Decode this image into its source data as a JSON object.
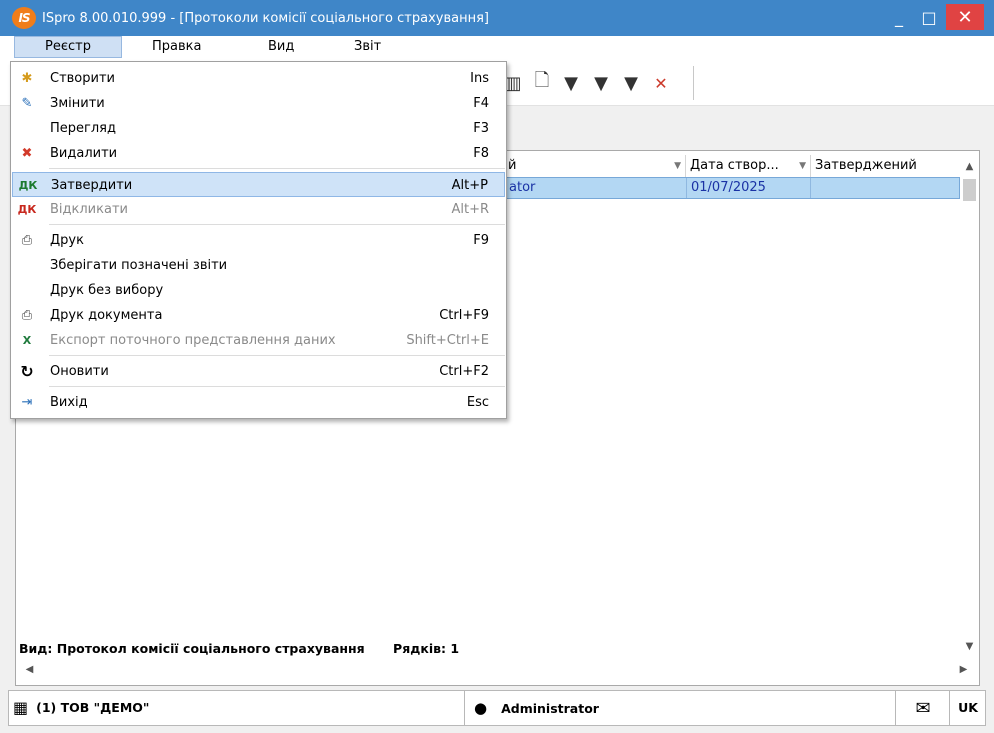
{
  "window": {
    "logo_text": "IS",
    "title": "ISpro 8.00.010.999 - [Протоколи комісії соціального страхування]",
    "minimize": "_",
    "maximize": "□",
    "close": "✕"
  },
  "menubar": [
    "Реєстр",
    "Правка",
    "Вид",
    "Звіт"
  ],
  "dropdown": {
    "items": [
      {
        "label": "Створити",
        "shortcut": "Ins",
        "icon": "new-doc-icon",
        "glyph": "✱"
      },
      {
        "label": "Змінити",
        "shortcut": "F4",
        "icon": "edit-doc-icon",
        "glyph": "✎"
      },
      {
        "label": "Перегляд",
        "shortcut": "F3",
        "icon": "",
        "glyph": ""
      },
      {
        "label": "Видалити",
        "shortcut": "F8",
        "icon": "delete-doc-icon",
        "glyph": "✖"
      },
      {
        "label": "Затвердити",
        "shortcut": "Alt+P",
        "icon": "approve-icon",
        "glyph": "ДК"
      },
      {
        "label": "Відкликати",
        "shortcut": "Alt+R",
        "icon": "revoke-icon",
        "glyph": "ДК"
      },
      {
        "label": "Друк",
        "shortcut": "F9",
        "icon": "printer-icon",
        "glyph": "⎙"
      },
      {
        "label": "Зберігати позначені звіти",
        "shortcut": "",
        "icon": "",
        "glyph": ""
      },
      {
        "label": "Друк без вибору",
        "shortcut": "",
        "icon": "",
        "glyph": ""
      },
      {
        "label": "Друк документа",
        "shortcut": "Ctrl+F9",
        "icon": "print-document-icon",
        "glyph": "⎙"
      },
      {
        "label": "Експорт поточного представлення даних",
        "shortcut": "Shift+Ctrl+E",
        "icon": "excel-export-icon",
        "glyph": "X"
      },
      {
        "label": "Оновити",
        "shortcut": "Ctrl+F2",
        "icon": "refresh-icon",
        "glyph": "↻"
      },
      {
        "label": "Вихід",
        "shortcut": "Esc",
        "icon": "exit-icon",
        "glyph": "⇥"
      }
    ]
  },
  "grid": {
    "columns": [
      {
        "label": "й"
      },
      {
        "label": "Дата створ..."
      },
      {
        "label": "Затверджений"
      }
    ],
    "rows": [
      {
        "cells": [
          "ator",
          "01/07/2025",
          ""
        ]
      }
    ]
  },
  "status": {
    "view": "Вид: Протокол комісії соціального страхування",
    "rows": "Рядків: 1"
  },
  "bottombar": {
    "org": "(1) ТОВ \"ДЕМО\"",
    "user": "Administrator",
    "lang": "UK"
  },
  "colors": {
    "titlebar": "#3f86c8",
    "close_button": "#e04343",
    "selection": "#b3d7f3",
    "link_text": "#1a32a5",
    "menu_highlight": "#cfe3f8"
  }
}
